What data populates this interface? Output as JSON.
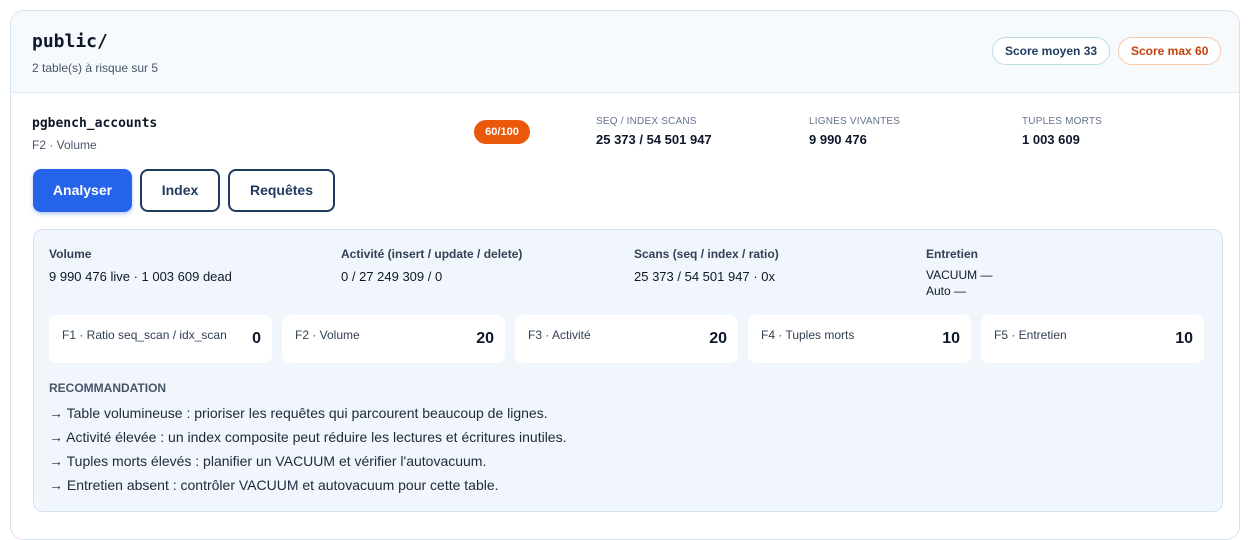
{
  "schema": {
    "title": "public/",
    "subtitle": "2 table(s) à risque sur 5",
    "score_avg": "Score moyen 33",
    "score_max": "Score max 60"
  },
  "table": {
    "name": "pgbench_accounts",
    "subtitle": "F2 · Volume",
    "score": "60/100",
    "metrics": [
      {
        "label": "SEQ / INDEX SCANS",
        "value": "25 373 / 54 501 947"
      },
      {
        "label": "LIGNES VIVANTES",
        "value": "9 990 476"
      },
      {
        "label": "TUPLES MORTS",
        "value": "1 003 609"
      }
    ]
  },
  "buttons": {
    "analyse": "Analyser",
    "index": "Index",
    "requetes": "Requêtes"
  },
  "details": {
    "columns": [
      {
        "title": "Volume",
        "value": "9 990 476 live · 1 003 609 dead"
      },
      {
        "title": "Activité (insert / update / delete)",
        "value": "0 / 27 249 309 / 0"
      },
      {
        "title": "Scans (seq / index / ratio)",
        "value": "25 373 / 54 501 947 · 0x"
      },
      {
        "title": "Entretien",
        "value_line1": "VACUUM —",
        "value_line2": "Auto —"
      }
    ],
    "factors": [
      {
        "label": "F1 · Ratio seq_scan / idx_scan",
        "value": "0"
      },
      {
        "label": "F2 · Volume",
        "value": "20"
      },
      {
        "label": "F3 · Activité",
        "value": "20"
      },
      {
        "label": "F4 · Tuples morts",
        "value": "10"
      },
      {
        "label": "F5 · Entretien",
        "value": "10"
      }
    ],
    "recommendation_title": "RECOMMANDATION",
    "recommendations": [
      "→ Table volumineuse : prioriser les requêtes qui parcourent beaucoup de lignes.",
      "→ Activité élevée : un index composite peut réduire les lectures et écritures inutiles.",
      "→ Tuples morts élevés : planifier un VACUUM et vérifier l'autovacuum.",
      "→ Entretien absent : contrôler VACUUM et autovacuum pour cette table."
    ]
  },
  "colors": {
    "primary": "#2563eb",
    "score_badge": "#ea580c",
    "navy": "#1e3a5f",
    "panel_bg": "#f1f6fc"
  }
}
